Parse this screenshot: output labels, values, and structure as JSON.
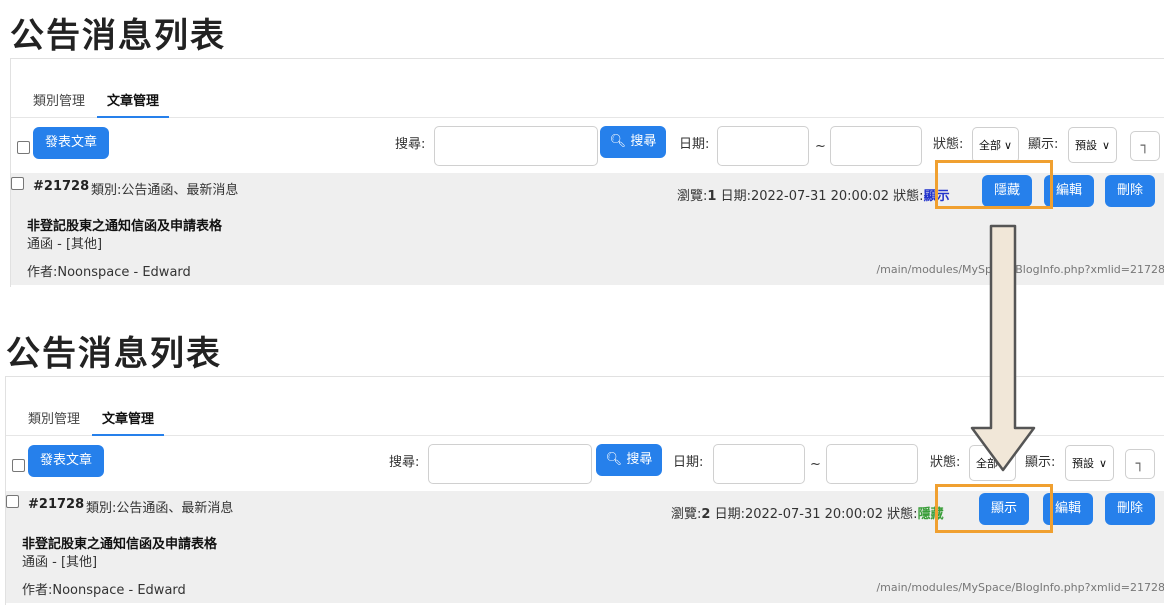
{
  "colors": {
    "accent": "#2680eb",
    "highlight": "#f0a030",
    "status_show": "#2233cc",
    "status_hide": "#3a9e3a",
    "arrow_fill": "#f1e7d8"
  },
  "panels": [
    {
      "title": "公告消息列表",
      "tabs": [
        "類別管理",
        "文章管理"
      ],
      "toolbar": {
        "post_button": "發表文章",
        "search_label": "搜尋:",
        "search_button": "搜尋",
        "date_label": "日期:",
        "date_sep": "~",
        "status_label": "狀態:",
        "status_value": "全部",
        "display_label": "顯示:",
        "display_value": "預設"
      },
      "item": {
        "id": "#21728",
        "category": "類別:公告通函、最新消息",
        "views_label": "瀏覽:",
        "views": "1",
        "date": "日期:2022-07-31 20:00:02",
        "status_label": "狀態:",
        "status": "顯示",
        "toggle_button": "隱藏",
        "edit_button": "編輯",
        "delete_button": "刪除",
        "title": "非登記股東之通知信函及申請表格",
        "type": "通函 - [其他]",
        "author": "作者:Noonspace - Edward",
        "url": "/main/modules/MySpace/BlogInfo.php?xmlid=21728"
      }
    },
    {
      "title": "公告消息列表",
      "tabs": [
        "類別管理",
        "文章管理"
      ],
      "toolbar": {
        "post_button": "發表文章",
        "search_label": "搜尋:",
        "search_button": "搜尋",
        "date_label": "日期:",
        "date_sep": "~",
        "status_label": "狀態:",
        "status_value": "全部",
        "display_label": "顯示:",
        "display_value": "預設"
      },
      "item": {
        "id": "#21728",
        "category": "類別:公告通函、最新消息",
        "views_label": "瀏覽:",
        "views": "2",
        "date": "日期:2022-07-31 20:00:02",
        "status_label": "狀態:",
        "status": "隱藏",
        "toggle_button": "顯示",
        "edit_button": "編輯",
        "delete_button": "刪除",
        "title": "非登記股東之通知信函及申請表格",
        "type": "通函 - [其他]",
        "author": "作者:Noonspace - Edward",
        "url": "/main/modules/MySpace/BlogInfo.php?xmlid=21728"
      }
    }
  ]
}
